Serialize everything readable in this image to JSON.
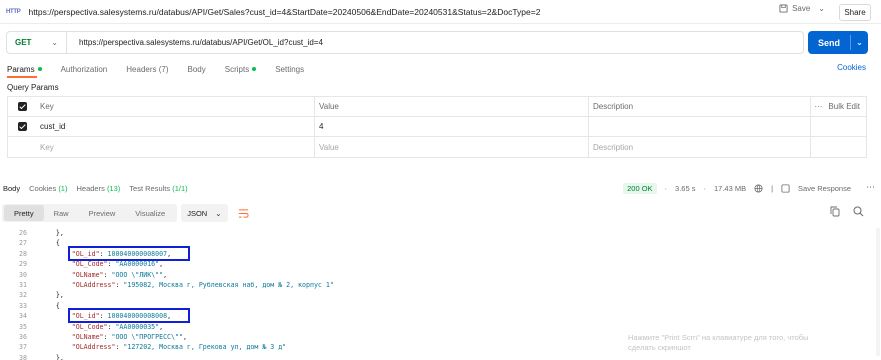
{
  "titlebar": {
    "http_badge": "HTTP",
    "title": "https://perspectiva.salesystems.ru/databus/API/Get/Sales?cust_id=4&StartDate=20240506&EndDate=20240531&Status=2&DocType=2",
    "save_label": "Save",
    "share_label": "Share"
  },
  "request": {
    "method": "GET",
    "url": "https://perspectiva.salesystems.ru/databus/API/Get/OL_id?cust_id=4",
    "send_label": "Send"
  },
  "request_tabs": [
    {
      "label": "Params",
      "dot": true
    },
    {
      "label": "Authorization",
      "dot": false
    },
    {
      "label": "Headers (7)",
      "dot": false
    },
    {
      "label": "Body",
      "dot": false
    },
    {
      "label": "Scripts",
      "dot": true
    },
    {
      "label": "Settings",
      "dot": false
    }
  ],
  "cookies_label": "Cookies",
  "query_params": {
    "title": "Query Params",
    "headers": {
      "key": "Key",
      "value": "Value",
      "description": "Description",
      "bulk_edit": "Bulk Edit"
    },
    "rows": [
      {
        "key": "cust_id",
        "value": "4"
      }
    ],
    "placeholders": {
      "key": "Key",
      "value": "Value",
      "description": "Description"
    }
  },
  "response_tabs": {
    "body": "Body",
    "cookies": "Cookies",
    "cookies_count": "(1)",
    "headers": "Headers",
    "headers_count": "(13)",
    "tests": "Test Results",
    "tests_count": "(1/1)"
  },
  "response_meta": {
    "status": "200 OK",
    "time": "3.65 s",
    "size": "17.43 MB",
    "save_response": "Save Response"
  },
  "format_tabs": [
    "Pretty",
    "Raw",
    "Preview",
    "Visualize"
  ],
  "format_select": "JSON",
  "code_lines": [
    {
      "n": "26",
      "parts": [
        {
          "t": "    },",
          "c": "b"
        }
      ]
    },
    {
      "n": "27",
      "parts": [
        {
          "t": "    {",
          "c": "b"
        }
      ]
    },
    {
      "n": "28",
      "parts": [
        {
          "t": "        ",
          "c": "b"
        },
        {
          "t": "\"OL_id\"",
          "c": "k"
        },
        {
          "t": ": ",
          "c": "b"
        },
        {
          "t": "100040000008007",
          "c": "n"
        },
        {
          "t": ",",
          "c": "b"
        }
      ]
    },
    {
      "n": "29",
      "parts": [
        {
          "t": "        ",
          "c": "b"
        },
        {
          "t": "\"OL_Code\"",
          "c": "k"
        },
        {
          "t": ": ",
          "c": "b"
        },
        {
          "t": "\"АА0000016\"",
          "c": "s"
        },
        {
          "t": ",",
          "c": "b"
        }
      ]
    },
    {
      "n": "30",
      "parts": [
        {
          "t": "        ",
          "c": "b"
        },
        {
          "t": "\"OLName\"",
          "c": "k"
        },
        {
          "t": ": ",
          "c": "b"
        },
        {
          "t": "\"ООО \\\"ЛИК\\\"\"",
          "c": "s"
        },
        {
          "t": ",",
          "c": "b"
        }
      ]
    },
    {
      "n": "31",
      "parts": [
        {
          "t": "        ",
          "c": "b"
        },
        {
          "t": "\"OLAddress\"",
          "c": "k"
        },
        {
          "t": ": ",
          "c": "b"
        },
        {
          "t": "\"195082, Москва г, Рублевская наб, дом № 2, корпус 1\"",
          "c": "s"
        }
      ]
    },
    {
      "n": "32",
      "parts": [
        {
          "t": "    },",
          "c": "b"
        }
      ]
    },
    {
      "n": "33",
      "parts": [
        {
          "t": "    {",
          "c": "b"
        }
      ]
    },
    {
      "n": "34",
      "parts": [
        {
          "t": "        ",
          "c": "b"
        },
        {
          "t": "\"OL_id\"",
          "c": "k"
        },
        {
          "t": ": ",
          "c": "b"
        },
        {
          "t": "100040000008008",
          "c": "n"
        },
        {
          "t": ",",
          "c": "b"
        }
      ]
    },
    {
      "n": "35",
      "parts": [
        {
          "t": "        ",
          "c": "b"
        },
        {
          "t": "\"OL_Code\"",
          "c": "k"
        },
        {
          "t": ": ",
          "c": "b"
        },
        {
          "t": "\"АА0000035\"",
          "c": "s"
        },
        {
          "t": ",",
          "c": "b"
        }
      ]
    },
    {
      "n": "36",
      "parts": [
        {
          "t": "        ",
          "c": "b"
        },
        {
          "t": "\"OLName\"",
          "c": "k"
        },
        {
          "t": ": ",
          "c": "b"
        },
        {
          "t": "\"ООО \\\"ПРОГРЕСС\\\"\"",
          "c": "s"
        },
        {
          "t": ",",
          "c": "b"
        }
      ]
    },
    {
      "n": "37",
      "parts": [
        {
          "t": "        ",
          "c": "b"
        },
        {
          "t": "\"OLAddress\"",
          "c": "k"
        },
        {
          "t": ": ",
          "c": "b"
        },
        {
          "t": "\"127202, Москва г, Грекова ул, дом № 3 д\"",
          "c": "s"
        }
      ]
    },
    {
      "n": "38",
      "parts": [
        {
          "t": "    },",
          "c": "b"
        }
      ]
    }
  ],
  "watermark": [
    "Нажмите \"Print Scrn\" на клавиатуре для того, чтобы",
    "сделать скриншот"
  ],
  "colors": {
    "send": "#0265d2",
    "accent": "#ff6c37",
    "status_ok": "#007f31",
    "highlight": "#1020d6"
  }
}
